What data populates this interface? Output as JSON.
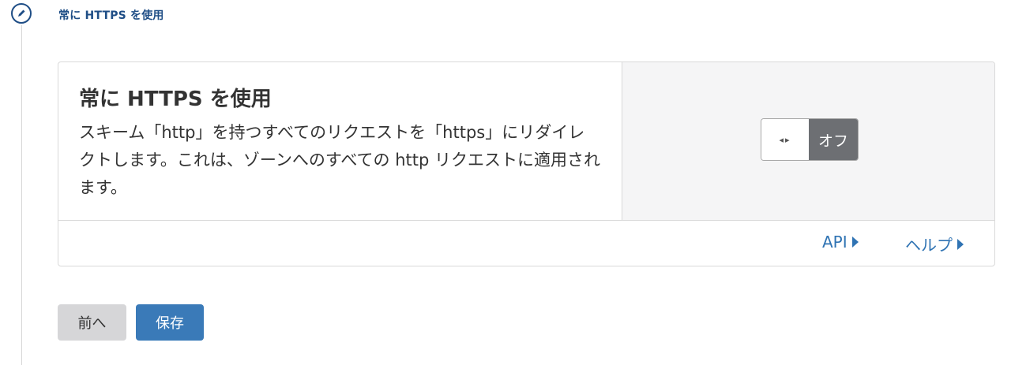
{
  "step": {
    "title": "常に HTTPS を使用",
    "icon": "pencil-icon"
  },
  "card": {
    "title": "常に HTTPS を使用",
    "description": "スキーム「http」を持つすべてのリクエストを「https」にリダイレクトします。これは、ゾーンへのすべての http リクエストに適用されます。",
    "toggle": {
      "state_label": "オフ",
      "knob_glyph": "◂▸",
      "enabled": false
    },
    "links": {
      "api": "API",
      "help": "ヘルプ"
    }
  },
  "buttons": {
    "prev": "前へ",
    "save": "保存"
  },
  "colors": {
    "accent": "#1f4e86",
    "link": "#2f73b3",
    "save_button": "#3a7ab8",
    "toggle_off": "#6d6f73"
  }
}
